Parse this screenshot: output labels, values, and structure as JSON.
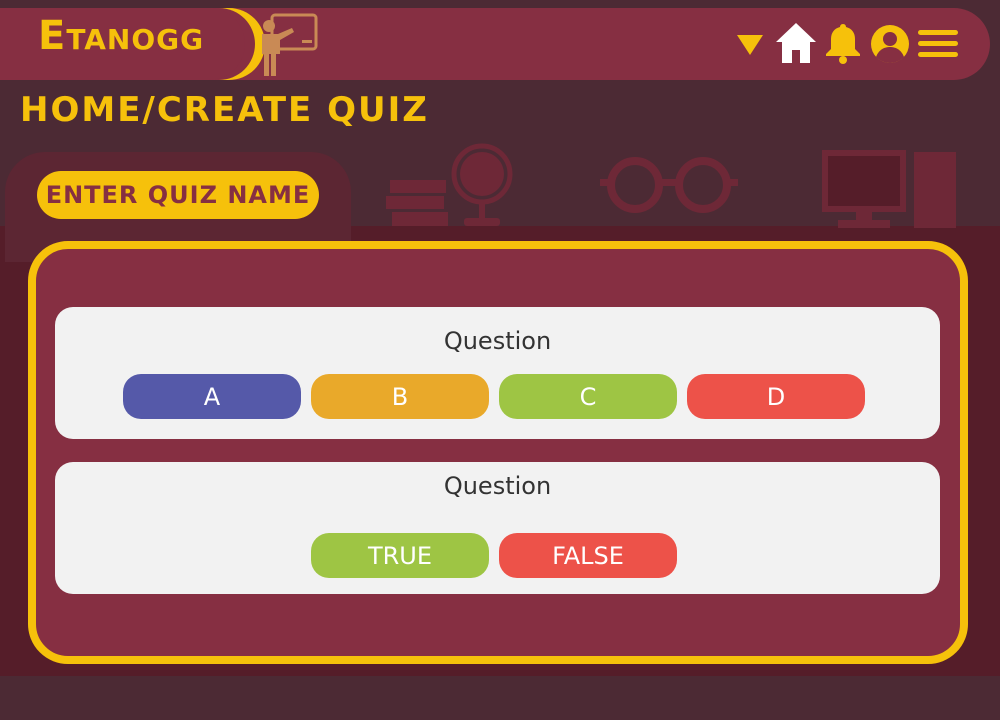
{
  "app": {
    "logo_text": "ETANOGG",
    "logo_first": "E",
    "logo_rest": "TANOGG"
  },
  "header": {
    "icons": [
      "dropdown-triangle-icon",
      "home-icon",
      "bell-icon",
      "user-icon",
      "menu-icon"
    ]
  },
  "breadcrumb": "HOME/CREATE QUIZ",
  "quiz_name_button": "ENTER QUIZ NAME",
  "questions": [
    {
      "label": "Question",
      "options": [
        {
          "label": "A",
          "color": "#5559a9"
        },
        {
          "label": "B",
          "color": "#e9a92a"
        },
        {
          "label": "C",
          "color": "#9ec544"
        },
        {
          "label": "D",
          "color": "#ed5249"
        }
      ]
    },
    {
      "label": "Question",
      "options": [
        {
          "label": "TRUE",
          "color": "#9ec544"
        },
        {
          "label": "FALSE",
          "color": "#ed5249"
        }
      ]
    }
  ],
  "colors": {
    "accent": "#f6c10b",
    "primary": "#862f42",
    "background": "#4c2a34"
  }
}
